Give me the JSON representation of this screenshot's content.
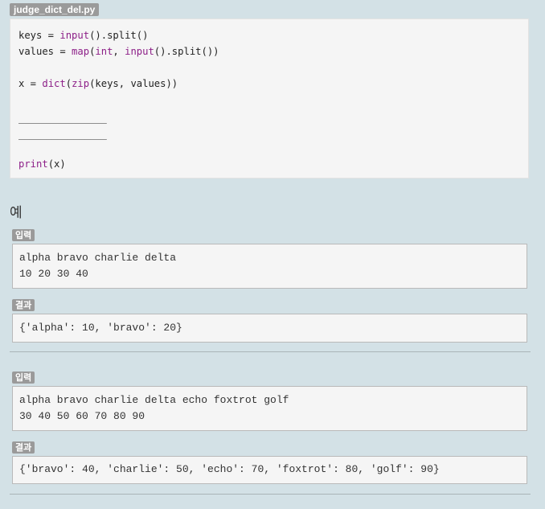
{
  "file": {
    "name": "judge_dict_del.py"
  },
  "code": {
    "line1_pre": "keys = ",
    "line1_fn": "input",
    "line1_post": "().split()",
    "line2_pre": "values = ",
    "line2_fn1": "map",
    "line2_mid1": "(",
    "line2_fn2": "int",
    "line2_mid2": ", ",
    "line2_fn3": "input",
    "line2_post": "().split())",
    "line3_pre": "x = ",
    "line3_fn1": "dict",
    "line3_mid": "(",
    "line3_fn2": "zip",
    "line3_post": "(keys, values))",
    "blank1": "________________",
    "blank2": "________________",
    "line6_fn": "print",
    "line6_post": "(x)"
  },
  "examples": {
    "heading": "예",
    "input_label": "입력",
    "output_label": "결과",
    "items": [
      {
        "input_line1": "alpha bravo charlie delta",
        "input_line2": "10 20 30 40",
        "output": "{'alpha': 10, 'bravo': 20}"
      },
      {
        "input_line1": "alpha bravo charlie delta echo foxtrot golf",
        "input_line2": "30 40 50 60 70 80 90",
        "output": "{'bravo': 40, 'charlie': 50, 'echo': 70, 'foxtrot': 80, 'golf': 90}"
      }
    ]
  }
}
